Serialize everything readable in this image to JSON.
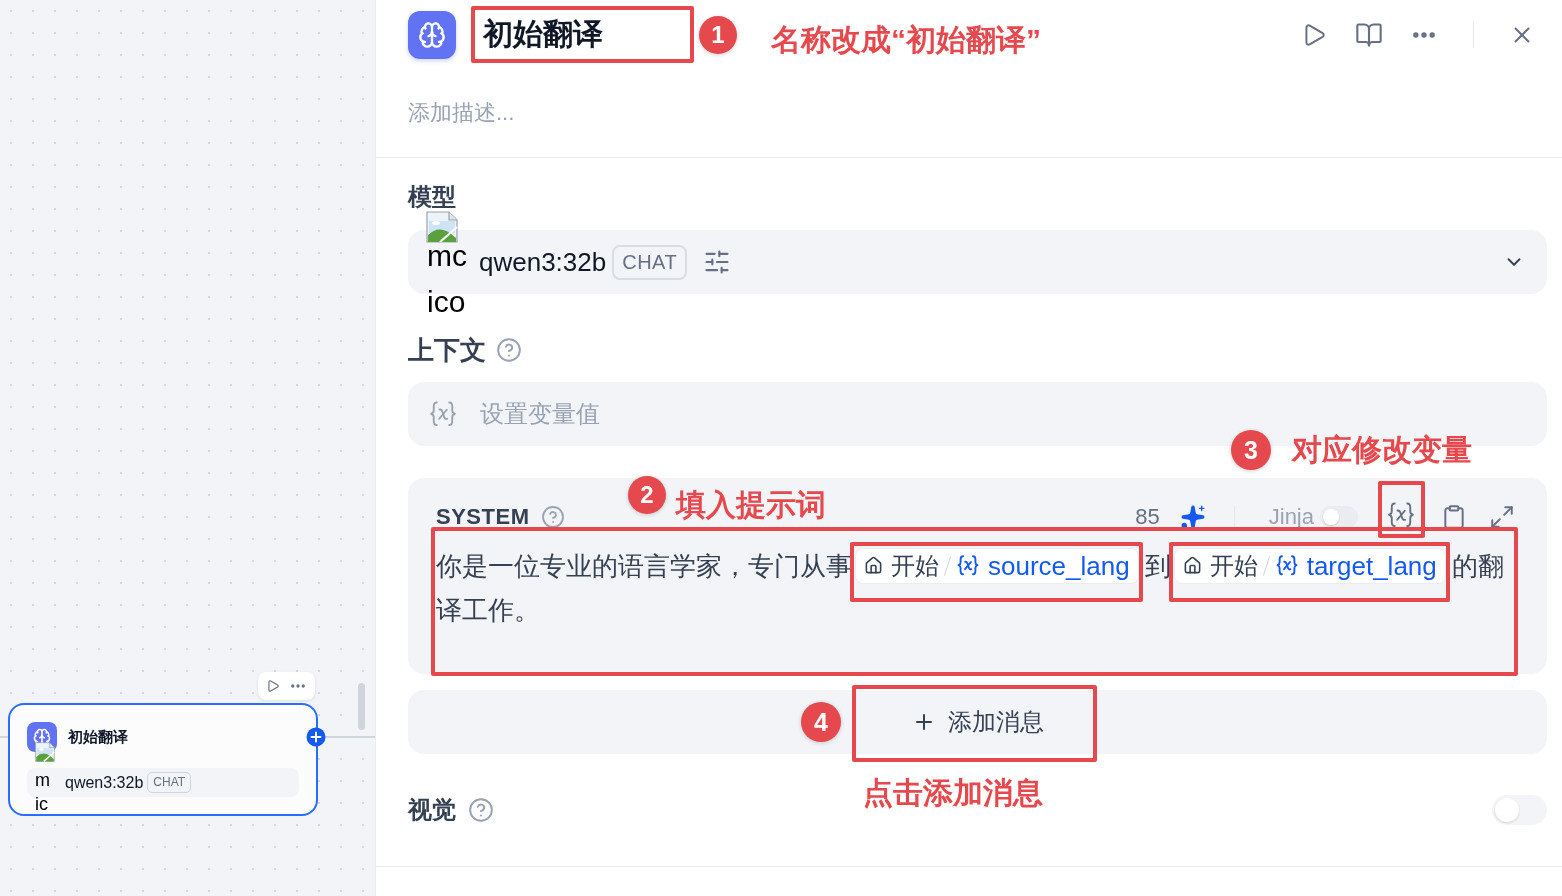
{
  "canvas_node": {
    "title": "初始翻译",
    "selected": true,
    "image_alt_lines": [
      "m",
      "ic"
    ],
    "model": {
      "name": "qwen3:32b",
      "mode": "CHAT"
    }
  },
  "panel": {
    "title": {
      "value": "初始翻译",
      "highlighted": true,
      "callout": {
        "number": "1",
        "text": "名称改成“初始翻译”"
      }
    },
    "description": {
      "placeholder": "添加描述..."
    },
    "model": {
      "label": "模型",
      "image_alt_lines": [
        "mc",
        "ico"
      ],
      "name": "qwen3:32b",
      "mode": "CHAT"
    },
    "context": {
      "label": "上下文",
      "placeholder": "设置变量值"
    },
    "system": {
      "label": "SYSTEM",
      "token_count": "85",
      "jinja": {
        "label": "Jinja",
        "on": false,
        "disabled": true
      },
      "variable_button": {
        "highlighted": true,
        "callout": {
          "number": "3",
          "text": "对应修改变量"
        }
      },
      "prompt": {
        "highlighted": true,
        "callout": {
          "number": "2",
          "text": "填入提示词"
        },
        "segments": [
          {
            "kind": "text",
            "text": "你是一位专业的语言学家，专门从事"
          },
          {
            "kind": "variable",
            "node": "开始",
            "name": "source_lang",
            "highlighted": true
          },
          {
            "kind": "text",
            "text": "到"
          },
          {
            "kind": "variable",
            "node": "开始",
            "name": "target_lang",
            "highlighted": true
          },
          {
            "kind": "text",
            "text": "的翻"
          },
          {
            "kind": "text",
            "text": "译工作。"
          }
        ]
      }
    },
    "add_message": {
      "label": "添加消息",
      "highlighted": true,
      "callout": {
        "number": "4",
        "text": "点击添加消息"
      }
    },
    "vision": {
      "label": "视觉",
      "on": false
    }
  }
}
